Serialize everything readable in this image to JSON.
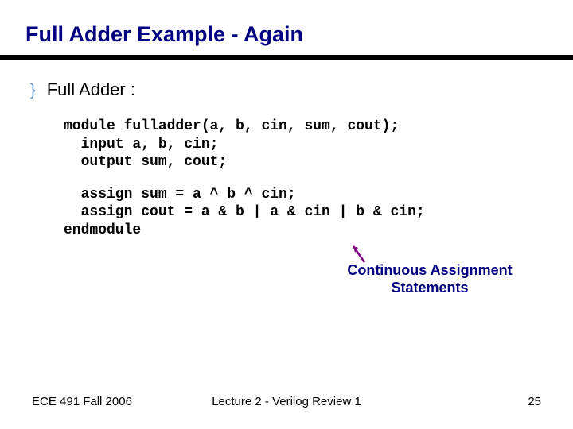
{
  "title": "Full Adder Example - Again",
  "bullet": {
    "glyph": "}",
    "text": "Full Adder :"
  },
  "code": {
    "block1": "module fulladder(a, b, cin, sum, cout);\n  input a, b, cin;\n  output sum, cout;",
    "block2": "  assign sum = a ^ b ^ cin;\n  assign cout = a & b | a & cin | b & cin;\nendmodule"
  },
  "annotation": "Continuous Assignment\nStatements",
  "footer": {
    "left": "ECE 491 Fall 2006",
    "center": "Lecture 2 - Verilog Review 1",
    "right": "25"
  }
}
